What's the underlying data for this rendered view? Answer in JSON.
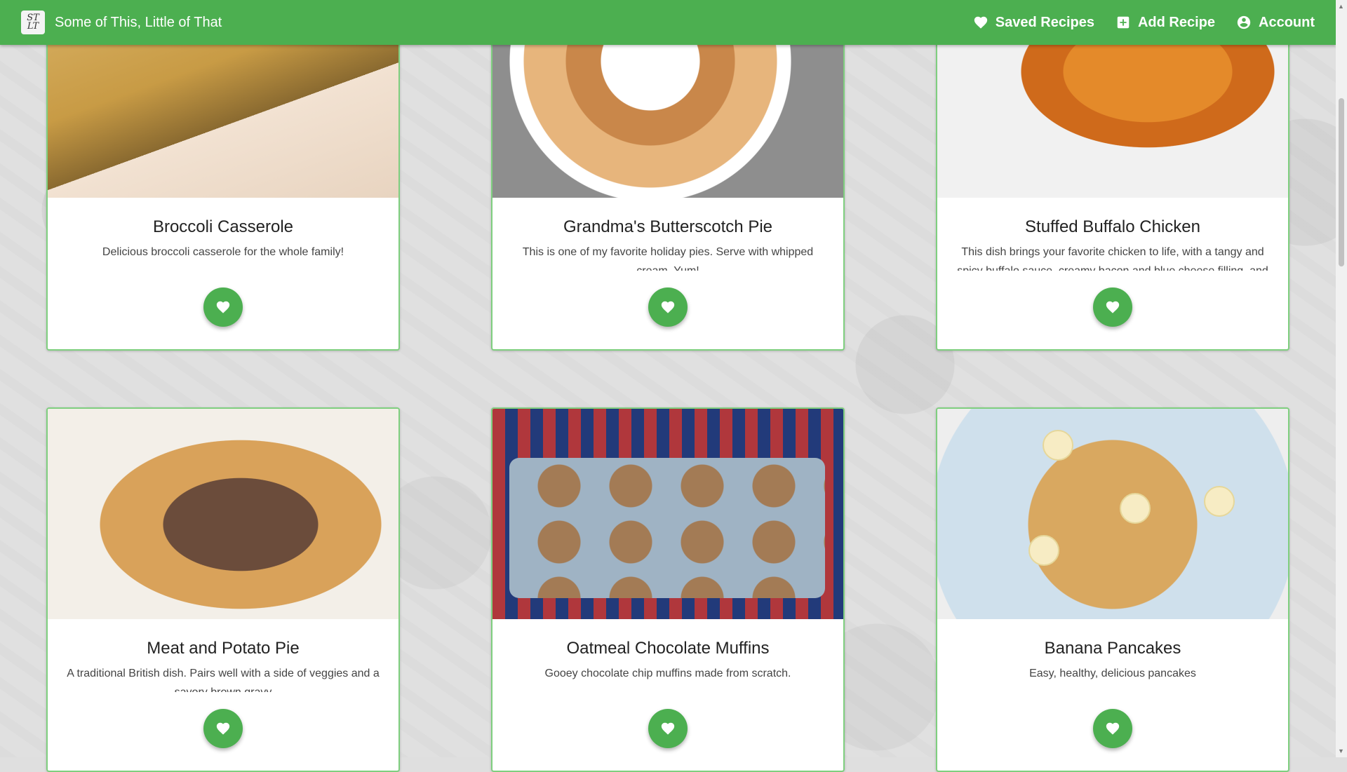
{
  "app": {
    "title": "Some of This, Little of That",
    "logo_text": "ST LT"
  },
  "nav": {
    "items": [
      {
        "label": "Saved Recipes",
        "icon": "heart-icon"
      },
      {
        "label": "Add Recipe",
        "icon": "plus-square-icon"
      },
      {
        "label": "Account",
        "icon": "account-circle-icon"
      }
    ]
  },
  "theme": {
    "primary": "#4caf50",
    "card_border": "#7fcf7f",
    "background": "#e0e0e0"
  },
  "recipes": [
    {
      "title": "Broccoli Casserole",
      "description": "Delicious broccoli casserole for the whole family!",
      "image": "broccoli-casserole-photo",
      "favorite_icon": "heart-icon"
    },
    {
      "title": "Grandma's Butterscotch Pie",
      "description": "This is one of my favorite holiday pies. Serve with whipped cream. Yum!",
      "image": "butterscotch-pie-photo",
      "favorite_icon": "heart-icon"
    },
    {
      "title": "Stuffed Buffalo Chicken",
      "description": "This dish brings your favorite chicken to life, with a tangy and spicy buffalo sauce, creamy bacon and blue cheese filling, and",
      "image": "buffalo-chicken-photo",
      "favorite_icon": "heart-icon"
    },
    {
      "title": "Meat and Potato Pie",
      "description": "A traditional British dish. Pairs well with a side of veggies and a savory brown gravy",
      "image": "meat-potato-pie-photo",
      "favorite_icon": "heart-icon"
    },
    {
      "title": "Oatmeal Chocolate Muffins",
      "description": "Gooey chocolate chip muffins made from scratch.",
      "image": "oatmeal-muffins-photo",
      "favorite_icon": "heart-icon"
    },
    {
      "title": "Banana Pancakes",
      "description": "Easy, healthy, delicious pancakes",
      "image": "banana-pancakes-photo",
      "favorite_icon": "heart-icon"
    }
  ]
}
